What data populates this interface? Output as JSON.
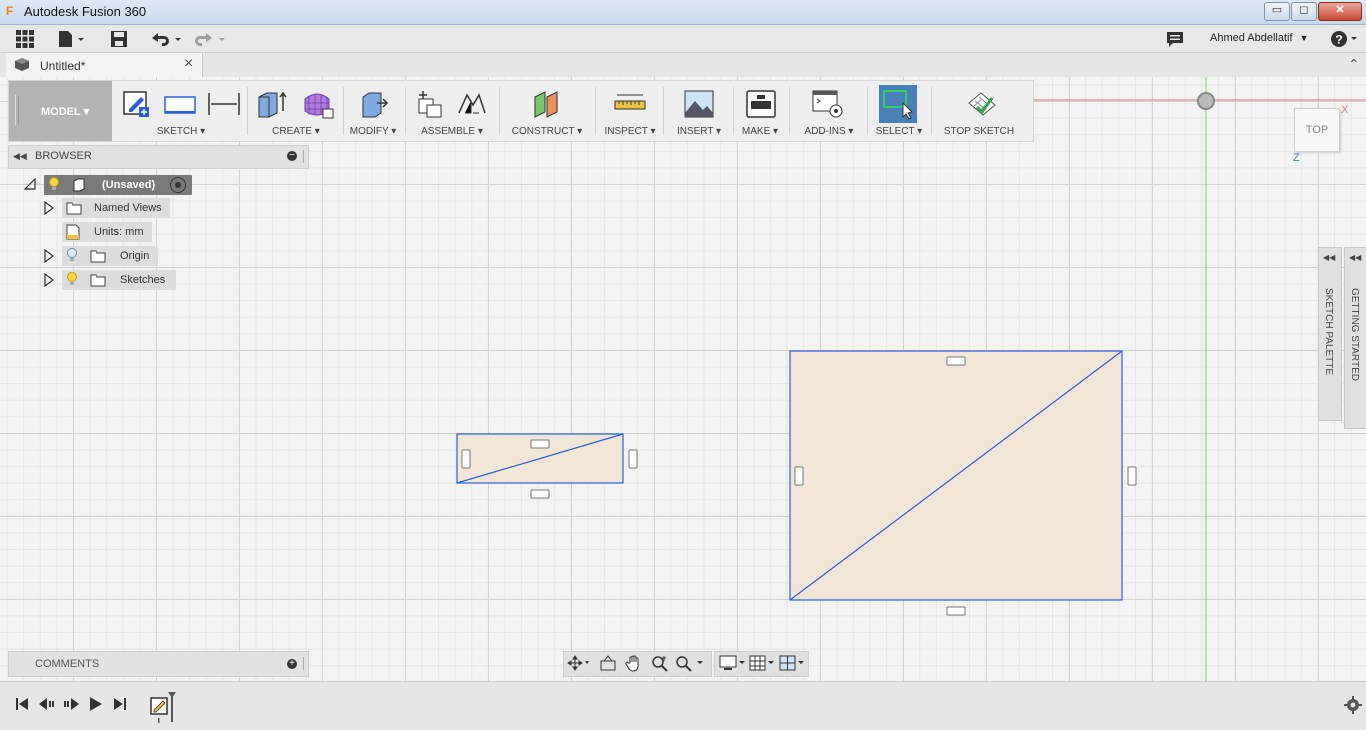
{
  "window": {
    "title": "Autodesk Fusion 360",
    "app_icon": "fusion-logo-icon",
    "controls": [
      "minimize-icon",
      "maximize-icon",
      "close-icon"
    ]
  },
  "quick_access": {
    "user_name": "Ahmed Abdellatif",
    "icons": [
      "apps-grid-icon",
      "file-icon",
      "save-icon",
      "undo-icon",
      "redo-icon",
      "notifications-icon",
      "help-icon"
    ]
  },
  "tab": {
    "title": "Untitled*",
    "close": "×"
  },
  "ribbon": {
    "workspace": "MODEL",
    "groups": [
      {
        "label": "SKETCH"
      },
      {
        "label": "CREATE"
      },
      {
        "label": "MODIFY"
      },
      {
        "label": "ASSEMBLE"
      },
      {
        "label": "CONSTRUCT"
      },
      {
        "label": "INSPECT"
      },
      {
        "label": "INSERT"
      },
      {
        "label": "MAKE"
      },
      {
        "label": "ADD-INS"
      },
      {
        "label": "SELECT"
      },
      {
        "label": "STOP SKETCH"
      }
    ]
  },
  "browser": {
    "header": "BROWSER",
    "root": "(Unsaved)",
    "items": [
      {
        "label": "Named Views"
      },
      {
        "label": "Units: mm"
      },
      {
        "label": "Origin"
      },
      {
        "label": "Sketches"
      }
    ]
  },
  "comments": {
    "label": "COMMENTS"
  },
  "viewcube": {
    "face": "TOP",
    "axis_x": "X",
    "axis_z": "Z"
  },
  "side_panels": {
    "sketch_palette": "SKETCH PALETTE",
    "getting_started": "GETTING STARTED"
  },
  "colors": {
    "sketch_line": "#2a5fd8",
    "sketch_fill": "#f1e6d8",
    "axis_red": "#e57373",
    "axis_green": "#7ccf6d",
    "select_active": "#4a7fb8"
  }
}
